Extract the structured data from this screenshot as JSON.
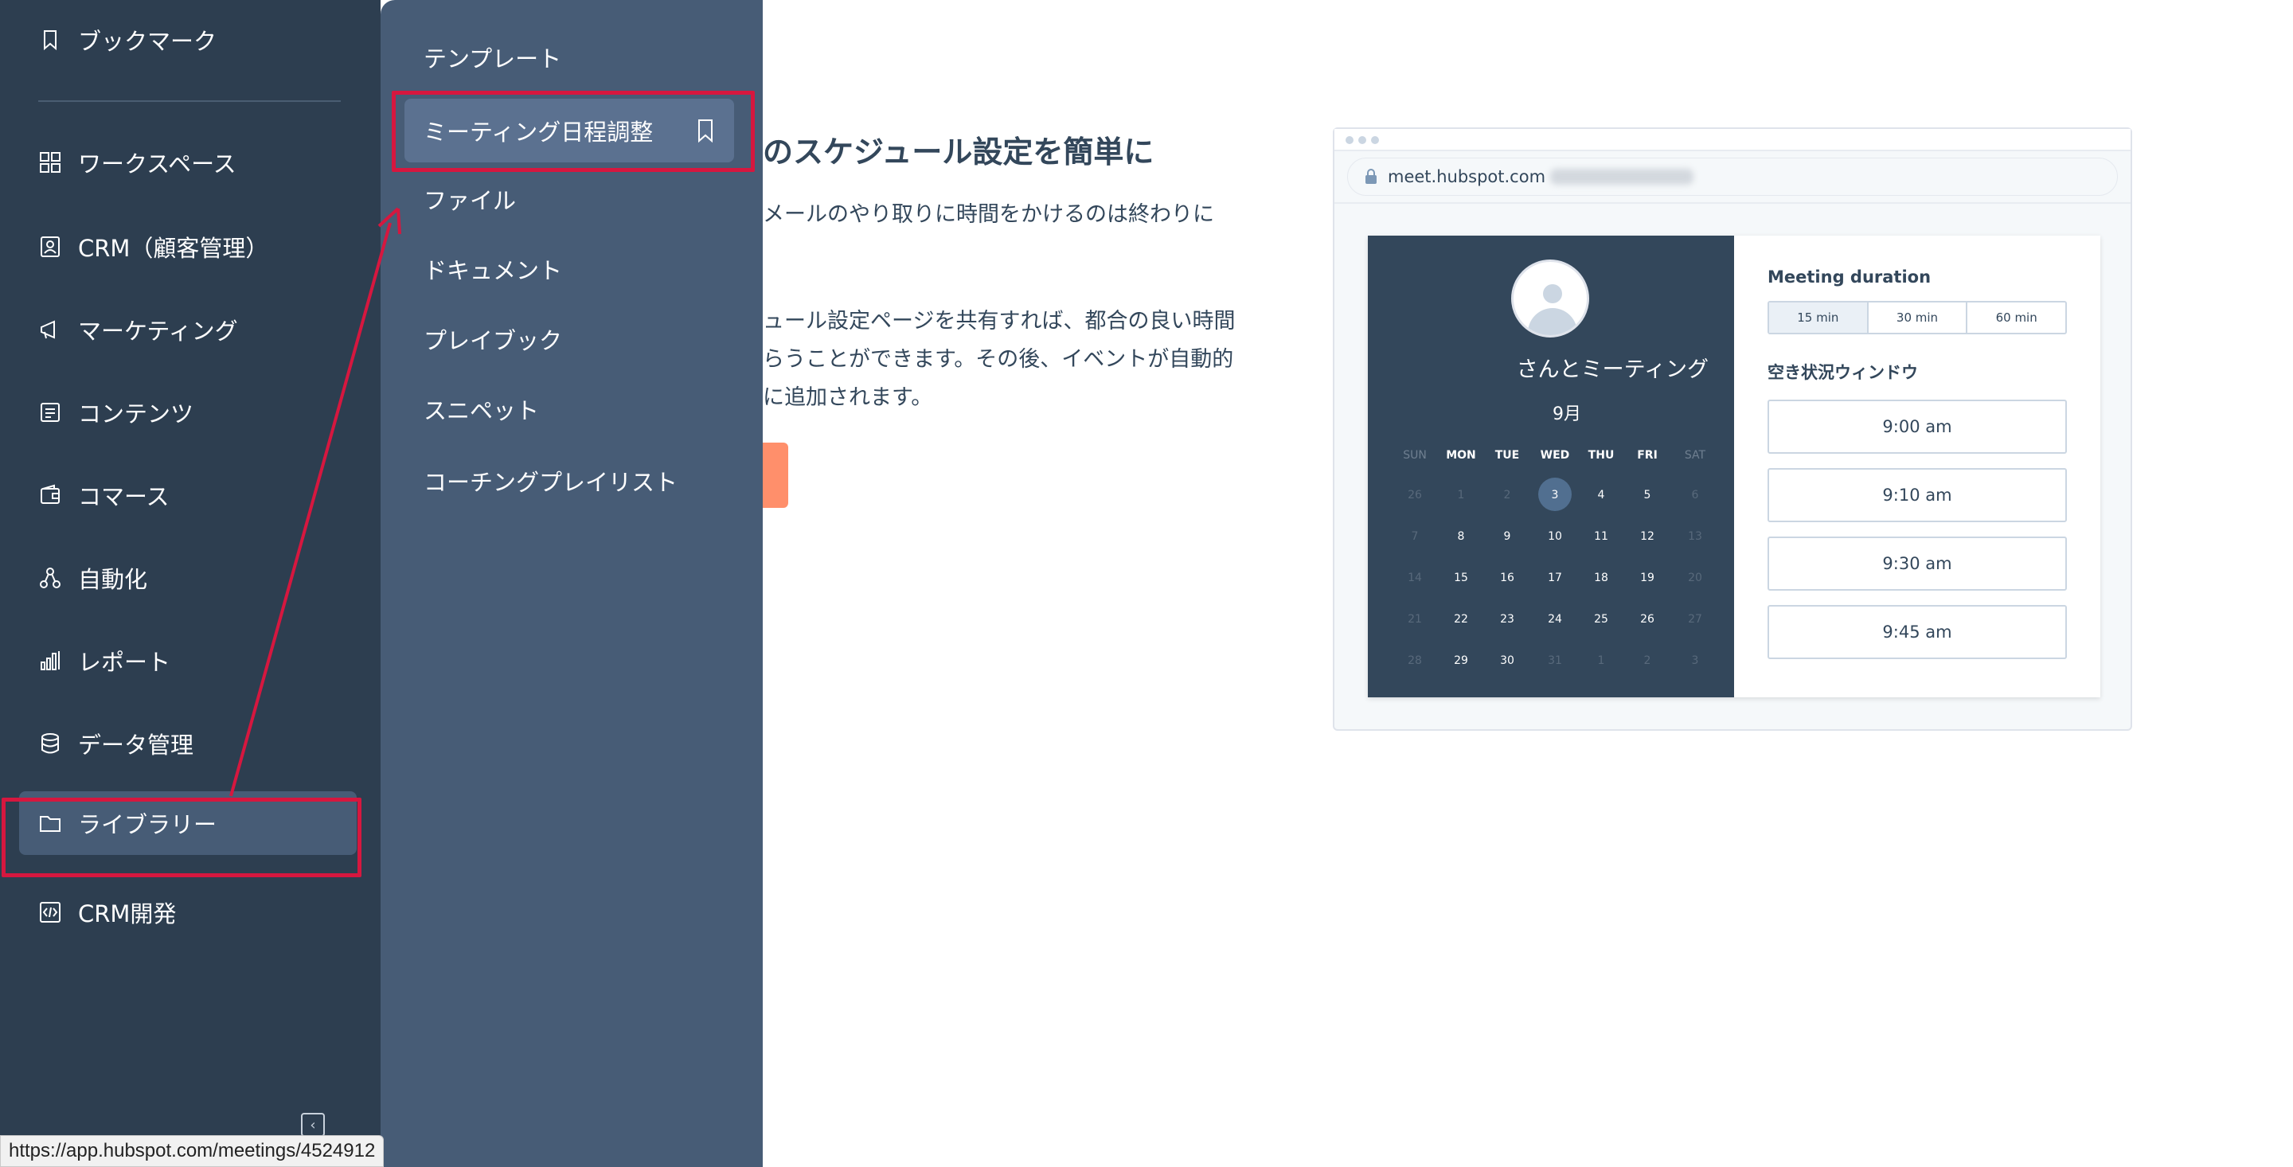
{
  "nav": {
    "items": [
      {
        "label": "ブックマーク",
        "icon": "bookmark-icon"
      },
      {
        "label": "ワークスペース",
        "icon": "grid-icon"
      },
      {
        "label": "CRM（顧客管理）",
        "icon": "contacts-icon"
      },
      {
        "label": "マーケティング",
        "icon": "megaphone-icon"
      },
      {
        "label": "コンテンツ",
        "icon": "content-icon"
      },
      {
        "label": "コマース",
        "icon": "wallet-icon"
      },
      {
        "label": "自動化",
        "icon": "workflow-icon"
      },
      {
        "label": "レポート",
        "icon": "bar-chart-icon"
      },
      {
        "label": "データ管理",
        "icon": "database-icon"
      },
      {
        "label": "ライブラリー",
        "icon": "folder-icon"
      },
      {
        "label": "CRM開発",
        "icon": "code-icon"
      }
    ],
    "collapse_glyph": "‹"
  },
  "flyout": {
    "items": [
      {
        "label": "テンプレート"
      },
      {
        "label": "ミーティング日程調整"
      },
      {
        "label": "ファイル"
      },
      {
        "label": "ドキュメント"
      },
      {
        "label": "プレイブック"
      },
      {
        "label": "スニペット"
      },
      {
        "label": "コーチングプレイリスト"
      }
    ]
  },
  "main": {
    "title": "のスケジュール設定を簡単に",
    "p1": "メールのやり取りに時間をかけるのは終わりに",
    "p2_line1": "ュール設定ページを共有すれば、都合の良い時間",
    "p2_line2": "らうことができます。その後、イベントが自動的",
    "p2_line3": "に追加されます。"
  },
  "mock": {
    "url": "meet.hubspot.com",
    "meeting_name": "さんとミーティング",
    "month": "9月",
    "weekdays": [
      "SUN",
      "MON",
      "TUE",
      "WED",
      "THU",
      "FRI",
      "SAT"
    ],
    "weeks": [
      [
        "26",
        "1",
        "2",
        "3",
        "4",
        "5",
        "6"
      ],
      [
        "7",
        "8",
        "9",
        "10",
        "11",
        "12",
        "13"
      ],
      [
        "14",
        "15",
        "16",
        "17",
        "18",
        "19",
        "20"
      ],
      [
        "21",
        "22",
        "23",
        "24",
        "25",
        "26",
        "27"
      ],
      [
        "28",
        "29",
        "30",
        "31",
        "1",
        "2",
        "3"
      ]
    ],
    "selected_day": "3",
    "duration_title": "Meeting duration",
    "durations": [
      "15 min",
      "30 min",
      "60 min"
    ],
    "selected_duration": "15 min",
    "availability_title": "空き状況ウィンドウ",
    "slots": [
      "9:00 am",
      "9:10 am",
      "9:30 am",
      "9:45 am"
    ]
  },
  "status_url": "https://app.hubspot.com/meetings/4524912",
  "colors": {
    "nav_bg": "#2d3e50",
    "flyout_bg": "#475c76",
    "highlight": "#d6173f",
    "cta": "#ff8f6b",
    "text_dark": "#33475b"
  }
}
